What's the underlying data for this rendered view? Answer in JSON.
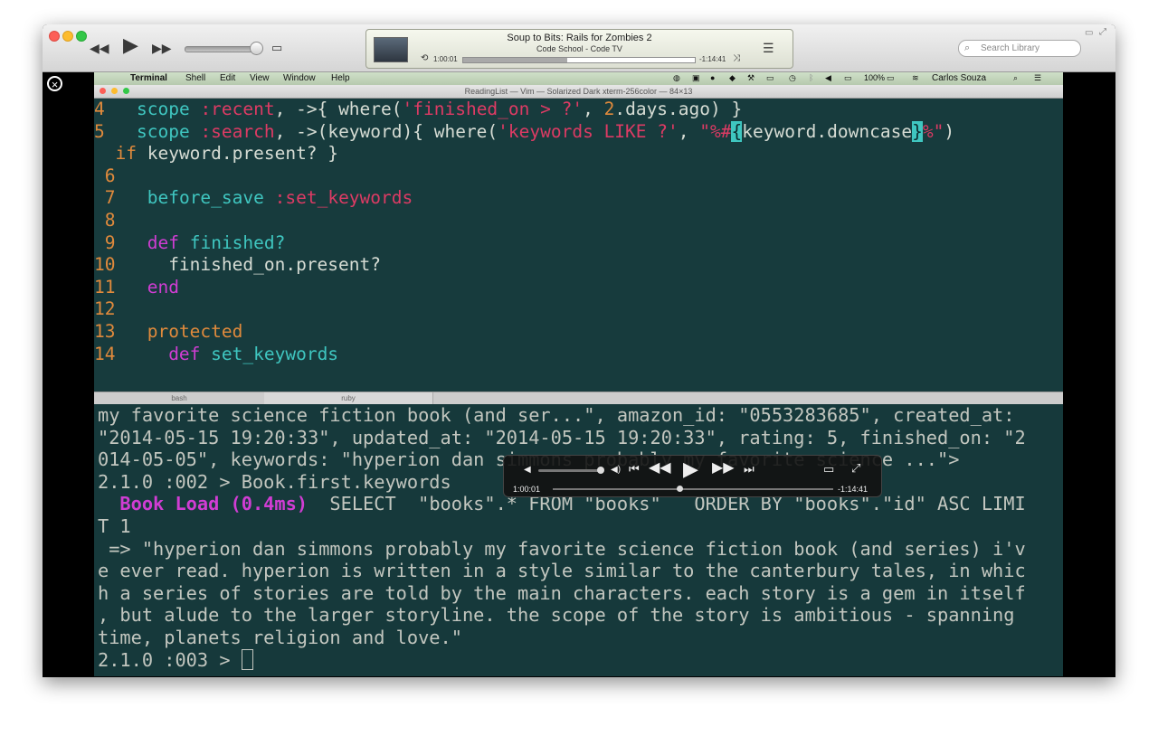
{
  "itunes": {
    "now_playing": {
      "title": "Soup to Bits: Rails for Zombies 2",
      "subtitle": "Code School - Code TV",
      "elapsed": "1:00:01",
      "remaining": "-1:14:41",
      "progress": 0.45
    },
    "volume": 0.95,
    "search_placeholder": "Search Library"
  },
  "menubar": {
    "apple": "",
    "items": [
      "Terminal",
      "Shell",
      "Edit",
      "View",
      "Window",
      "Help"
    ],
    "battery": "100%",
    "user": "Carlos Souza"
  },
  "terminal": {
    "title": "ReadingList — Vim — Solarized Dark xterm-256color — 84×13",
    "tabs": [
      "bash",
      "ruby"
    ]
  },
  "vim": {
    "lines": [
      {
        "num": "4",
        "kind": "scope_recent"
      },
      {
        "num": "5",
        "kind": "scope_search"
      },
      {
        "num": "",
        "kind": "cont"
      },
      {
        "num": "6",
        "kind": "blank"
      },
      {
        "num": "7",
        "kind": "before_save"
      },
      {
        "num": "8",
        "kind": "blank"
      },
      {
        "num": "9",
        "kind": "def_finished"
      },
      {
        "num": "10",
        "kind": "finished_on"
      },
      {
        "num": "11",
        "kind": "end"
      },
      {
        "num": "12",
        "kind": "blank"
      },
      {
        "num": "13",
        "kind": "protected"
      },
      {
        "num": "14",
        "kind": "def_set"
      }
    ],
    "tokens": {
      "scope": "scope",
      "recent_sym": ":recent",
      "recent_rest": ", ->{ where(",
      "recent_str": "'finished_on > ?'",
      "recent_sep": ", ",
      "recent_num": "2",
      "recent_end": ".days.ago) }",
      "search_sym": ":search",
      "search_rest": ", ->(keyword){ where(",
      "search_str": "'keywords LIKE ?'",
      "search_sep": ", ",
      "search_q1": "\"%#",
      "search_c1": "{",
      "search_mid": "keyword.downcase",
      "search_c2": "}",
      "search_q2": "%\"",
      "search_close": ")",
      "cont_if": "if",
      "cont_rest": " keyword.present? }",
      "before_save": "before_save",
      "set_keywords_sym": ":set_keywords",
      "def": "def",
      "finished": "finished?",
      "finished_on": "finished_on.present?",
      "end": "end",
      "protected": "protected",
      "set_keywords": "set_keywords"
    }
  },
  "irb": {
    "line1": "my favorite science fiction book (and ser...\", amazon_id: \"0553283685\", created_at:",
    "line2": "\"2014-05-15 19:20:33\", updated_at: \"2014-05-15 19:20:33\", rating: 5, finished_on: \"2",
    "line3": "014-05-05\", keywords: \"hyperion dan simmons probably my favorite science ...\">",
    "prompt2": "2.1.0 :002 > Book.first.keywords",
    "book_load": "Book Load (0.4ms)",
    "sql": "  SELECT  \"books\".* FROM \"books\"   ORDER BY \"books\".\"id\" ASC LIMI",
    "sql2": "T 1",
    "result1": " => \"hyperion dan simmons probably my favorite science fiction book (and series) i'v",
    "result2": "e ever read. hyperion is written in a style similar to the canterbury tales, in whic",
    "result3": "h a series of stories are told by the main characters. each story is a gem in itself",
    "result4": ", but alude to the larger storyline. the scope of the story is ambitious - spanning",
    "result5": "time, planets religion and love.\"",
    "prompt3": "2.1.0 :003 > "
  },
  "hud": {
    "elapsed": "1:00:01",
    "remaining": "-1:14:41",
    "progress": 0.45
  }
}
